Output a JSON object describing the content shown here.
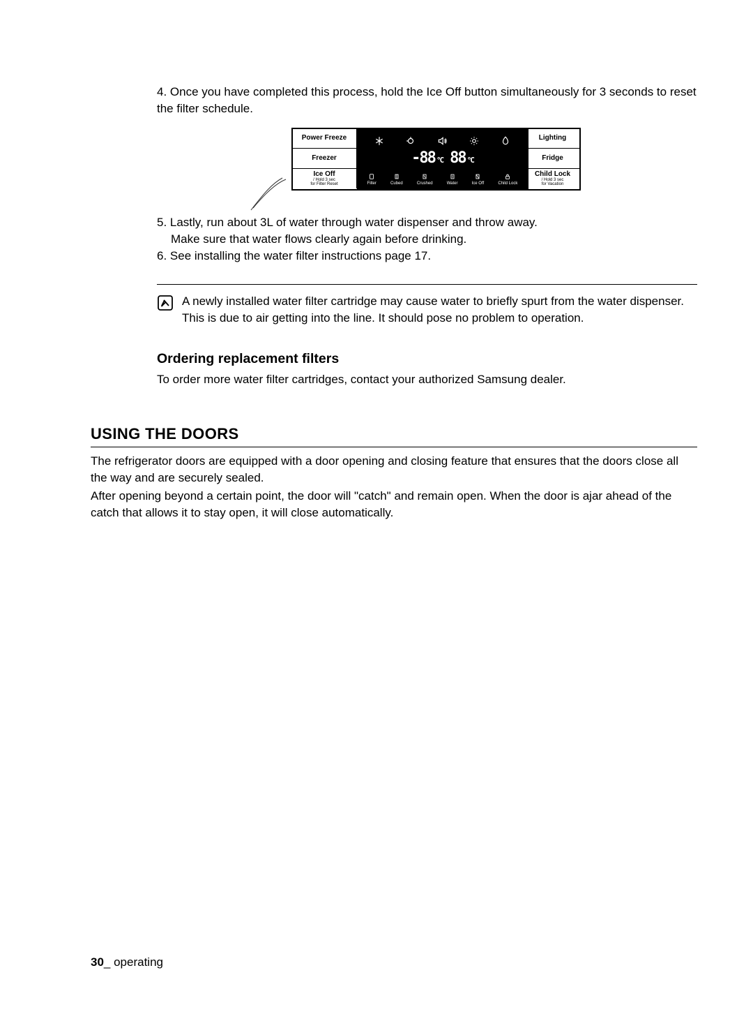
{
  "steps": {
    "s4": "4. Once you have completed this process, hold the Ice Off button simultaneously for 3 seconds to reset the filter schedule.",
    "s5_line1": "5. Lastly, run about 3L of water through water dispenser and throw away.",
    "s5_line2": "Make sure that water flows clearly again before drinking.",
    "s6": "6. See installing the water filter instructions page 17."
  },
  "panel": {
    "left": {
      "powerFreeze": "Power Freeze",
      "freezer": "Freezer",
      "iceOff": "Ice Off",
      "iceOffSub1": "/ Hold 3 sec",
      "iceOffSub2": "for Filter Reset"
    },
    "right": {
      "lighting": "Lighting",
      "fridge": "Fridge",
      "childLock": "Child Lock",
      "childLockSub1": "/ Hold 3 sec",
      "childLockSub2": "for Vacation"
    },
    "center": {
      "leftTemp": "-88",
      "leftDeg": "°C",
      "rightTemp": "88",
      "rightDeg": "°C",
      "bottom": {
        "filter": "Filter",
        "cubed": "Cubed",
        "crushed": "Crushed",
        "water": "Water",
        "iceOff": "Ice Off",
        "childLock": "Child Lock"
      }
    }
  },
  "note": "A newly installed water filter cartridge may cause water to briefly spurt from the water dispenser. This is due to air getting into the line. It should pose no problem to operation.",
  "ordering": {
    "heading": "Ordering replacement filters",
    "body": "To order more water filter cartridges, contact your authorized Samsung dealer."
  },
  "doors": {
    "heading": "USING THE DOORS",
    "p1": "The refrigerator doors are equipped with a door opening and closing feature that ensures that the doors close all the way and are securely sealed.",
    "p2": "After opening beyond a certain point, the door will \"catch\" and remain open. When the door is ajar ahead of the catch that allows it to stay open, it will close automatically."
  },
  "footer": {
    "pageNum": "30",
    "suffix": "_ operating"
  }
}
